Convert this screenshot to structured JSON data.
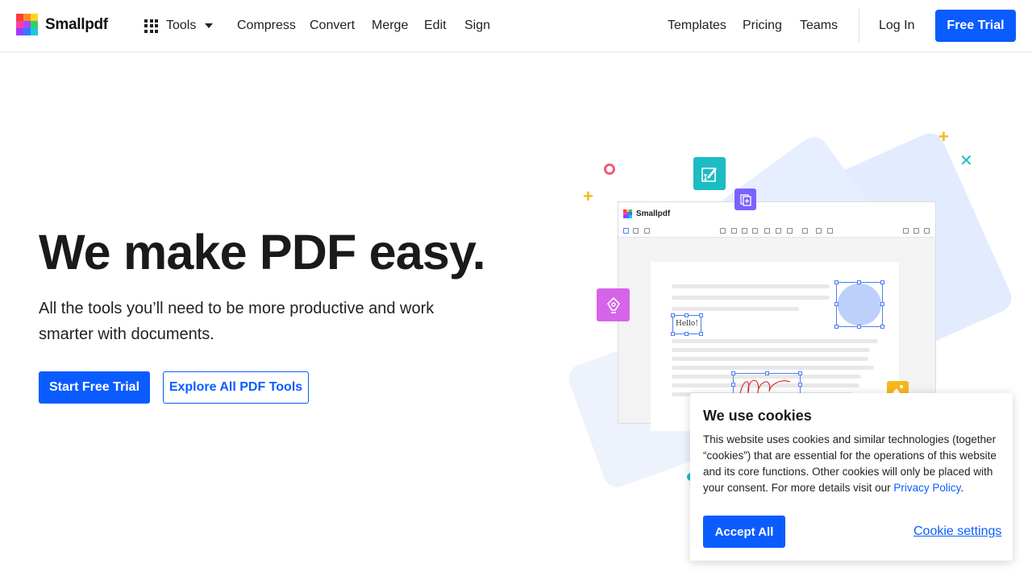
{
  "header": {
    "brand": "Smallpdf",
    "tools_label": "Tools",
    "nav_left": [
      "Compress",
      "Convert",
      "Merge",
      "Edit",
      "Sign"
    ],
    "nav_right": [
      "Templates",
      "Pricing",
      "Teams"
    ],
    "login_label": "Log In",
    "trial_label": "Free Trial"
  },
  "hero": {
    "title": "We make PDF easy.",
    "subtitle": "All the tools you’ll need to be more productive and work smarter with documents.",
    "primary_cta": "Start Free Trial",
    "secondary_cta": "Explore All PDF Tools"
  },
  "illustration": {
    "app_brand": "Smallpdf",
    "sample_text": "Hello!"
  },
  "cookie": {
    "title": "We use cookies",
    "body": "This website uses cookies and similar technologies (together “cookies”) that are essential for the operations of this website and its core functions. Other cookies will only be placed with your consent. For more details visit our ",
    "link_label": "Privacy Policy",
    "body_end": ".",
    "accept_label": "Accept All",
    "settings_label": "Cookie settings"
  },
  "colors": {
    "accent": "#0a5cff",
    "teal": "#1bbcc4",
    "purple": "#7b61ff",
    "magenta": "#d664e8",
    "yellow": "#f5b81c",
    "pink": "#f25a7a"
  }
}
